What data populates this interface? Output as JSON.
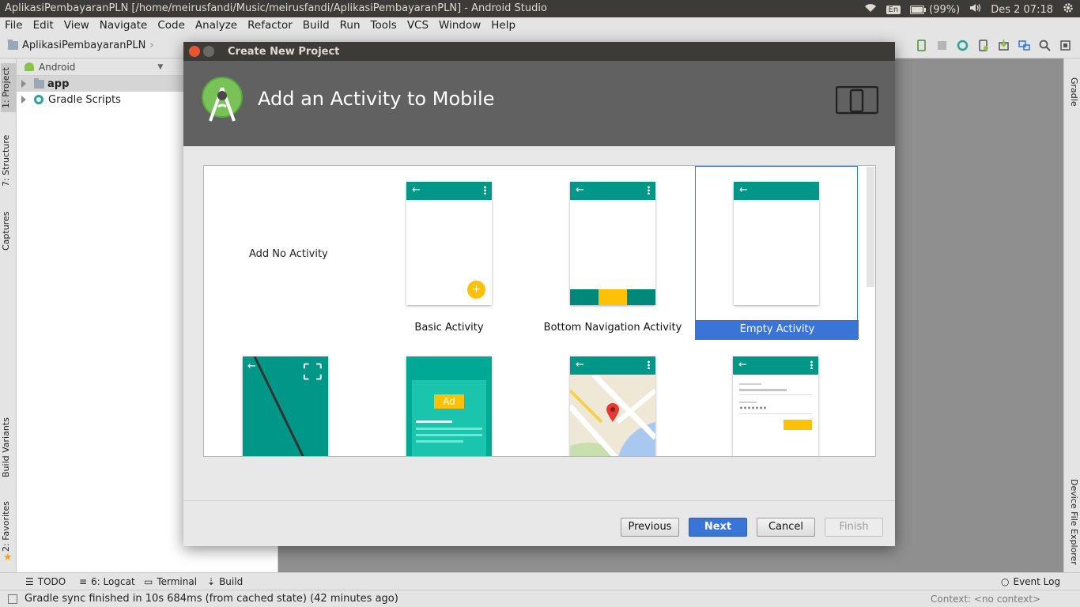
{
  "os_bar": {
    "window_title": "AplikasiPembayaranPLN [/home/meirusfandi/Music/meirusfandi/AplikasiPembayaranPLN] - Android Studio",
    "lang": "En",
    "battery": "(99%)",
    "clock": "Des 2 07:18"
  },
  "menu": [
    "File",
    "Edit",
    "View",
    "Navigate",
    "Code",
    "Analyze",
    "Refactor",
    "Build",
    "Run",
    "Tools",
    "VCS",
    "Window",
    "Help"
  ],
  "breadcrumb": {
    "project": "AplikasiPembayaranPLN"
  },
  "left_tabs": {
    "project": "1: Project",
    "structure": "7: Structure",
    "captures": "Captures",
    "build_variants": "Build Variants",
    "favorites": "2: Favorites"
  },
  "right_tabs": {
    "gradle": "Gradle",
    "device_explorer": "Device File Explorer"
  },
  "project_panel": {
    "view_mode": "Android",
    "tree": [
      {
        "label": "app"
      },
      {
        "label": "Gradle Scripts"
      }
    ]
  },
  "dialog": {
    "window_title": "Create New Project",
    "header_title": "Add an Activity to Mobile",
    "tiles": {
      "add_no_activity": "Add No Activity",
      "basic": "Basic Activity",
      "bottom_nav": "Bottom Navigation Activity",
      "empty": "Empty Activity",
      "ad_label": "Ad"
    },
    "selected_tile": "Empty Activity",
    "buttons": {
      "previous": "Previous",
      "next": "Next",
      "cancel": "Cancel",
      "finish": "Finish"
    }
  },
  "bottom_tools": {
    "todo": "TODO",
    "logcat": "6: Logcat",
    "terminal": "Terminal",
    "build": "Build",
    "event_log": "Event Log"
  },
  "status": {
    "message": "Gradle sync finished in 10s 684ms (from cached state) (42 minutes ago)",
    "context": "Context: <no context>"
  },
  "colors": {
    "accent": "#3875d7",
    "teal": "#009688",
    "amber": "#ffc107",
    "header": "#616161"
  }
}
